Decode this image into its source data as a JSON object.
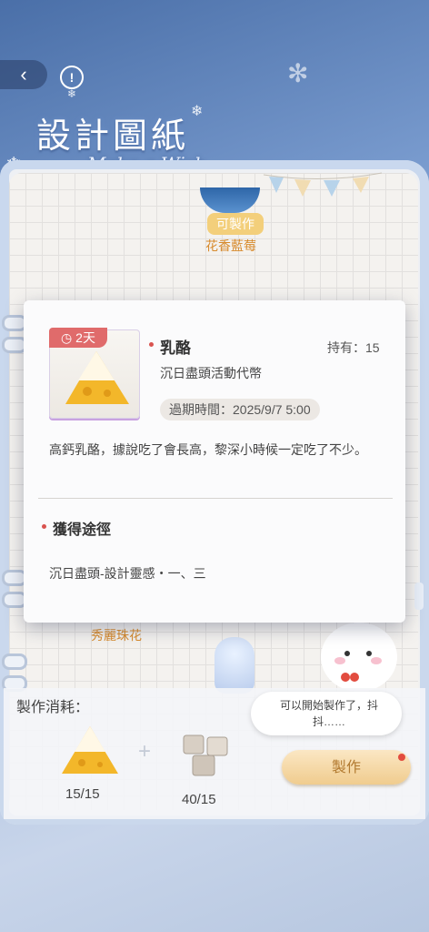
{
  "header": {
    "back_icon": "chevron-left-icon",
    "info_icon": "info-icon",
    "title": "設計圖紙",
    "subtitle": "Make a Wish"
  },
  "notebook": {
    "craftable_label": "可製作",
    "product_name": "花香藍莓",
    "background_item_name": "秀麗珠花"
  },
  "item_popup": {
    "expiry_badge": "2天",
    "name": "乳酪",
    "owned": "持有：15",
    "type": "沉日盡頭活動代幣",
    "expiry": "過期時間：2025/9/7 5:00",
    "description": "高鈣乳酪，據說吃了會長高，黎深小時候一定吃了不少。",
    "source_title": "獲得途徑",
    "source_text": "沉日盡頭-設計靈感・一、三"
  },
  "crafting": {
    "cost_label": "製作消耗：",
    "speech_bubble": "可以開始製作了，抖抖……",
    "materials": [
      {
        "icon": "cheese-icon",
        "count": "15/15"
      },
      {
        "icon": "crystal-cubes-icon",
        "count": "40/15"
      }
    ],
    "make_button": "製作"
  },
  "colors": {
    "accent_gold": "#f0cc8e",
    "label_orange": "#d78a2c",
    "badge_red": "#e06b6b"
  }
}
